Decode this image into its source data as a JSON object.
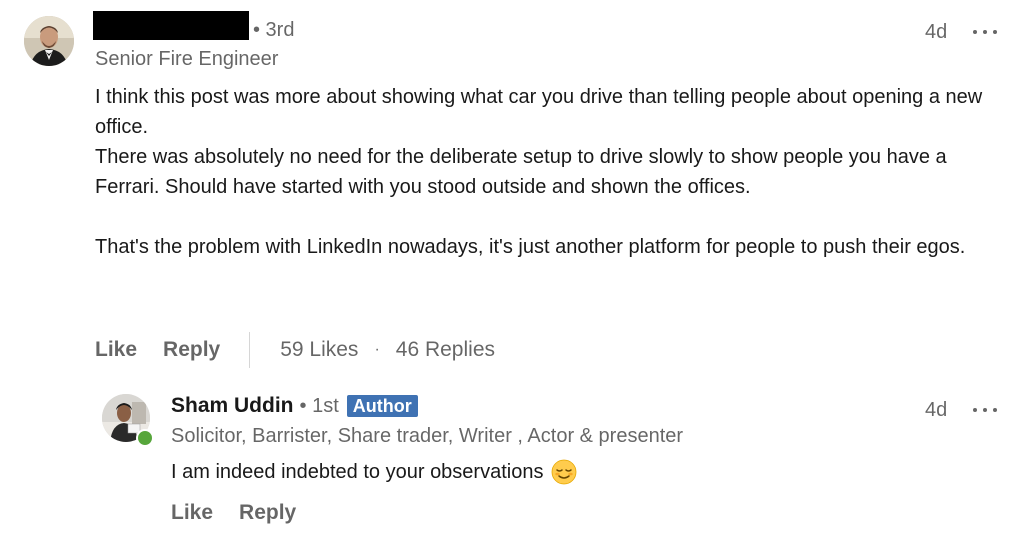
{
  "comment": {
    "degree": "• 3rd",
    "headline": "Senior Fire Engineer",
    "time": "4d",
    "more_icon": "ellipsis-horizontal-icon",
    "body": {
      "p1": "I think this post was more about showing what car you drive than telling people about opening a new office.",
      "p2": "There was absolutely no need for the deliberate setup to drive slowly to show people you have a Ferrari. Should have started with you stood outside and shown the offices.",
      "p3": "That's the problem with LinkedIn nowadays, it's just another platform for people to push their egos."
    },
    "actions": {
      "like": "Like",
      "reply": "Reply",
      "likes_count": "59 Likes",
      "separator": "·",
      "replies_count": "46 Replies"
    }
  },
  "reply": {
    "name": "Sham Uddin",
    "degree": "• 1st",
    "badge": "Author",
    "headline": "Solicitor, Barrister, Share trader, Writer , Actor & presenter",
    "time": "4d",
    "more_icon": "ellipsis-horizontal-icon",
    "body": "I am indeed indebted to your observations",
    "emoji_icon": "relieved-face-emoji-icon",
    "online_status_color": "#57a63b",
    "actions": {
      "like": "Like",
      "reply": "Reply"
    }
  },
  "colors": {
    "author_badge": "#3f72b3",
    "secondary_text": "rgba(0,0,0,0.6)",
    "primary_text": "rgba(0,0,0,0.9)"
  }
}
